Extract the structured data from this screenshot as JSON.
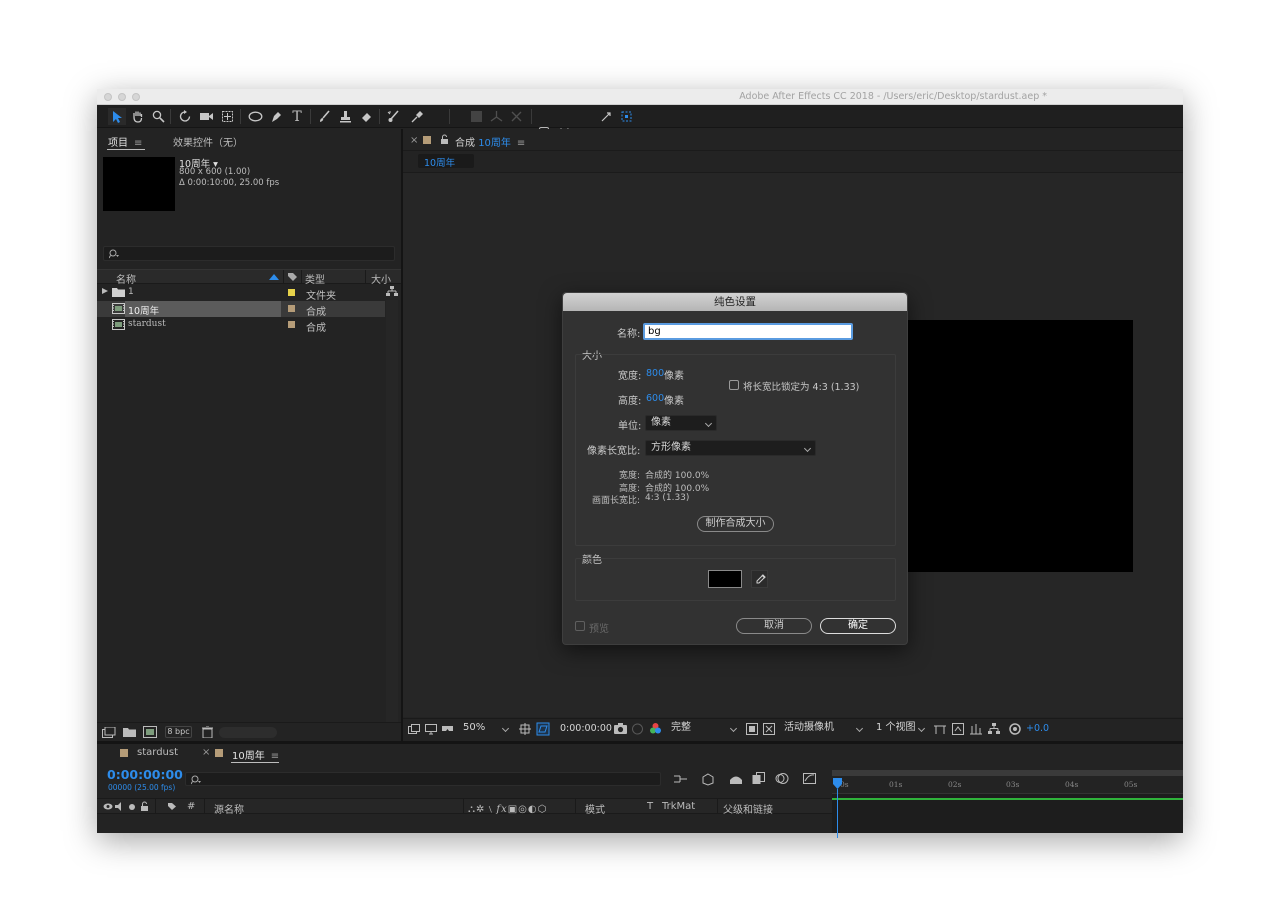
{
  "window": {
    "title": "Adobe After Effects CC 2018 - /Users/eric/Desktop/stardust.aep *"
  },
  "toolbar": {
    "align_label": "对齐"
  },
  "project_panel": {
    "tab_project": "项目",
    "tab_effects": "效果控件（无）",
    "comp_name": "10周年",
    "comp_size": "800 x 600 (1.00)",
    "comp_duration": "Δ 0:00:10:00, 25.00 fps",
    "search_placeholder": "",
    "columns": {
      "name": "名称",
      "type": "类型",
      "size": "大小"
    },
    "items": [
      {
        "name": "1",
        "type": "文件夹",
        "label_color": "#e6d24a",
        "icon": "folder-icon"
      },
      {
        "name": "10周年",
        "type": "合成",
        "label_color": "#b59c78",
        "icon": "composition-icon",
        "selected": true
      },
      {
        "name": "stardust",
        "type": "合成",
        "label_color": "#b59c78",
        "icon": "composition-icon"
      }
    ],
    "bpc": "8 bpc"
  },
  "comp_panel": {
    "tab_prefix": "合成",
    "tab_name": "10周年",
    "subtab": "10周年",
    "zoom": "50%",
    "timecode": "0:00:00:00",
    "resolution": "完整",
    "camera": "活动摄像机",
    "views": "1 个视图",
    "exposure": "+0.0"
  },
  "dialog": {
    "title": "纯色设置",
    "name_label": "名称:",
    "name_value": "bg",
    "size_group": "大小",
    "width_label": "宽度:",
    "width_value": "800",
    "width_unit": "像素",
    "height_label": "高度:",
    "height_value": "600",
    "height_unit": "像素",
    "lock_label": "将长宽比锁定为 4:3 (1.33)",
    "units_label": "单位:",
    "units_value": "像素",
    "par_label": "像素长宽比:",
    "par_value": "方形像素",
    "info_width_label": "宽度:",
    "info_width_value": "合成的 100.0%",
    "info_height_label": "高度:",
    "info_height_value": "合成的 100.0%",
    "info_frame_label": "画面长宽比:",
    "info_frame_value": "4:3 (1.33)",
    "make_comp_size": "制作合成大小",
    "color_group": "颜色",
    "color_value": "#000000",
    "preview_label": "预览",
    "cancel": "取消",
    "ok": "确定"
  },
  "timeline": {
    "tabs": [
      {
        "name": "stardust"
      },
      {
        "name": "10周年"
      }
    ],
    "timecode": "0:00:00:00",
    "frames": "00000 (25.00 fps)",
    "col_number": "#",
    "col_source": "源名称",
    "col_mode": "模式",
    "col_t": "T",
    "col_trkmat": "TrkMat",
    "col_parent": "父级和链接",
    "ruler": [
      "0s",
      "01s",
      "02s",
      "03s",
      "04s",
      "05s"
    ]
  }
}
